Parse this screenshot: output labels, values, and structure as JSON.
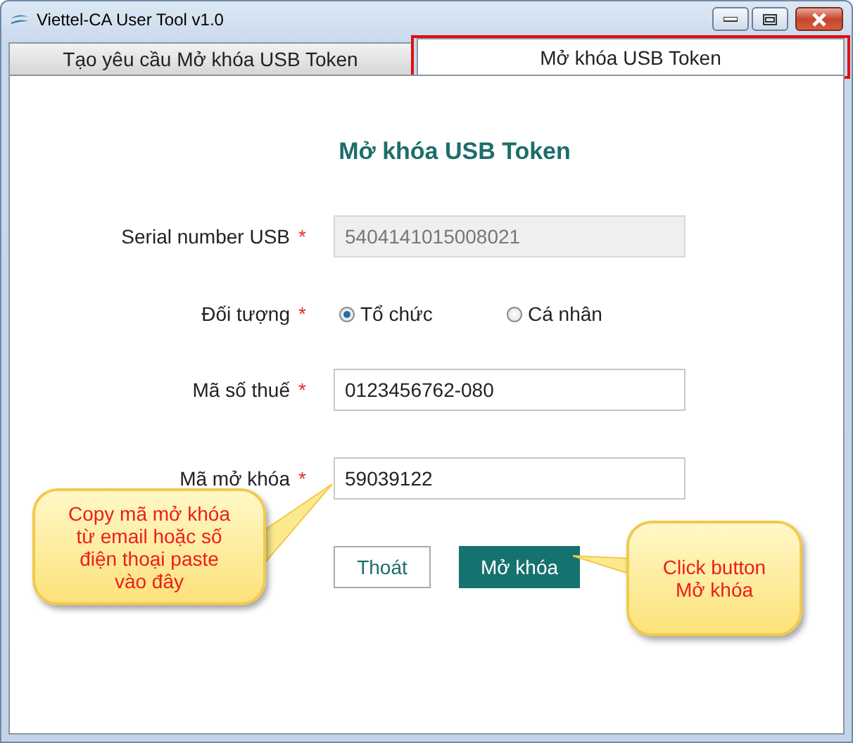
{
  "window": {
    "title": "Viettel-CA User Tool v1.0"
  },
  "tabs": [
    {
      "label": "Tạo yêu cầu Mở khóa USB Token",
      "selected": false,
      "highlighted": false
    },
    {
      "label": "Mở khóa USB Token",
      "selected": true,
      "highlighted": true
    }
  ],
  "form": {
    "heading": "Mở khóa USB Token",
    "fields": [
      {
        "kind": "text",
        "label": "Serial number USB",
        "required_mark": "*",
        "value": "5404141015008021",
        "disabled": true
      },
      {
        "kind": "radio",
        "label": "Đối tượng",
        "required_mark": "*",
        "options": [
          {
            "label": "Tổ chức",
            "selected": true
          },
          {
            "label": "Cá nhân",
            "selected": false
          }
        ]
      },
      {
        "kind": "text",
        "label": "Mã số thuế",
        "required_mark": "*",
        "value": "0123456762-080",
        "disabled": false
      },
      {
        "kind": "text",
        "label": "Mã mở khóa",
        "required_mark": "*",
        "value": "59039122",
        "disabled": false
      }
    ]
  },
  "buttons": [
    {
      "label": "Thoát",
      "kind": "secondary"
    },
    {
      "label": "Mở khóa",
      "kind": "primary"
    }
  ],
  "callouts": [
    {
      "text": "Copy mã mở khóa từ email hoặc số điện thoại paste vào đây"
    },
    {
      "text": "Click button Mở khóa"
    }
  ]
}
